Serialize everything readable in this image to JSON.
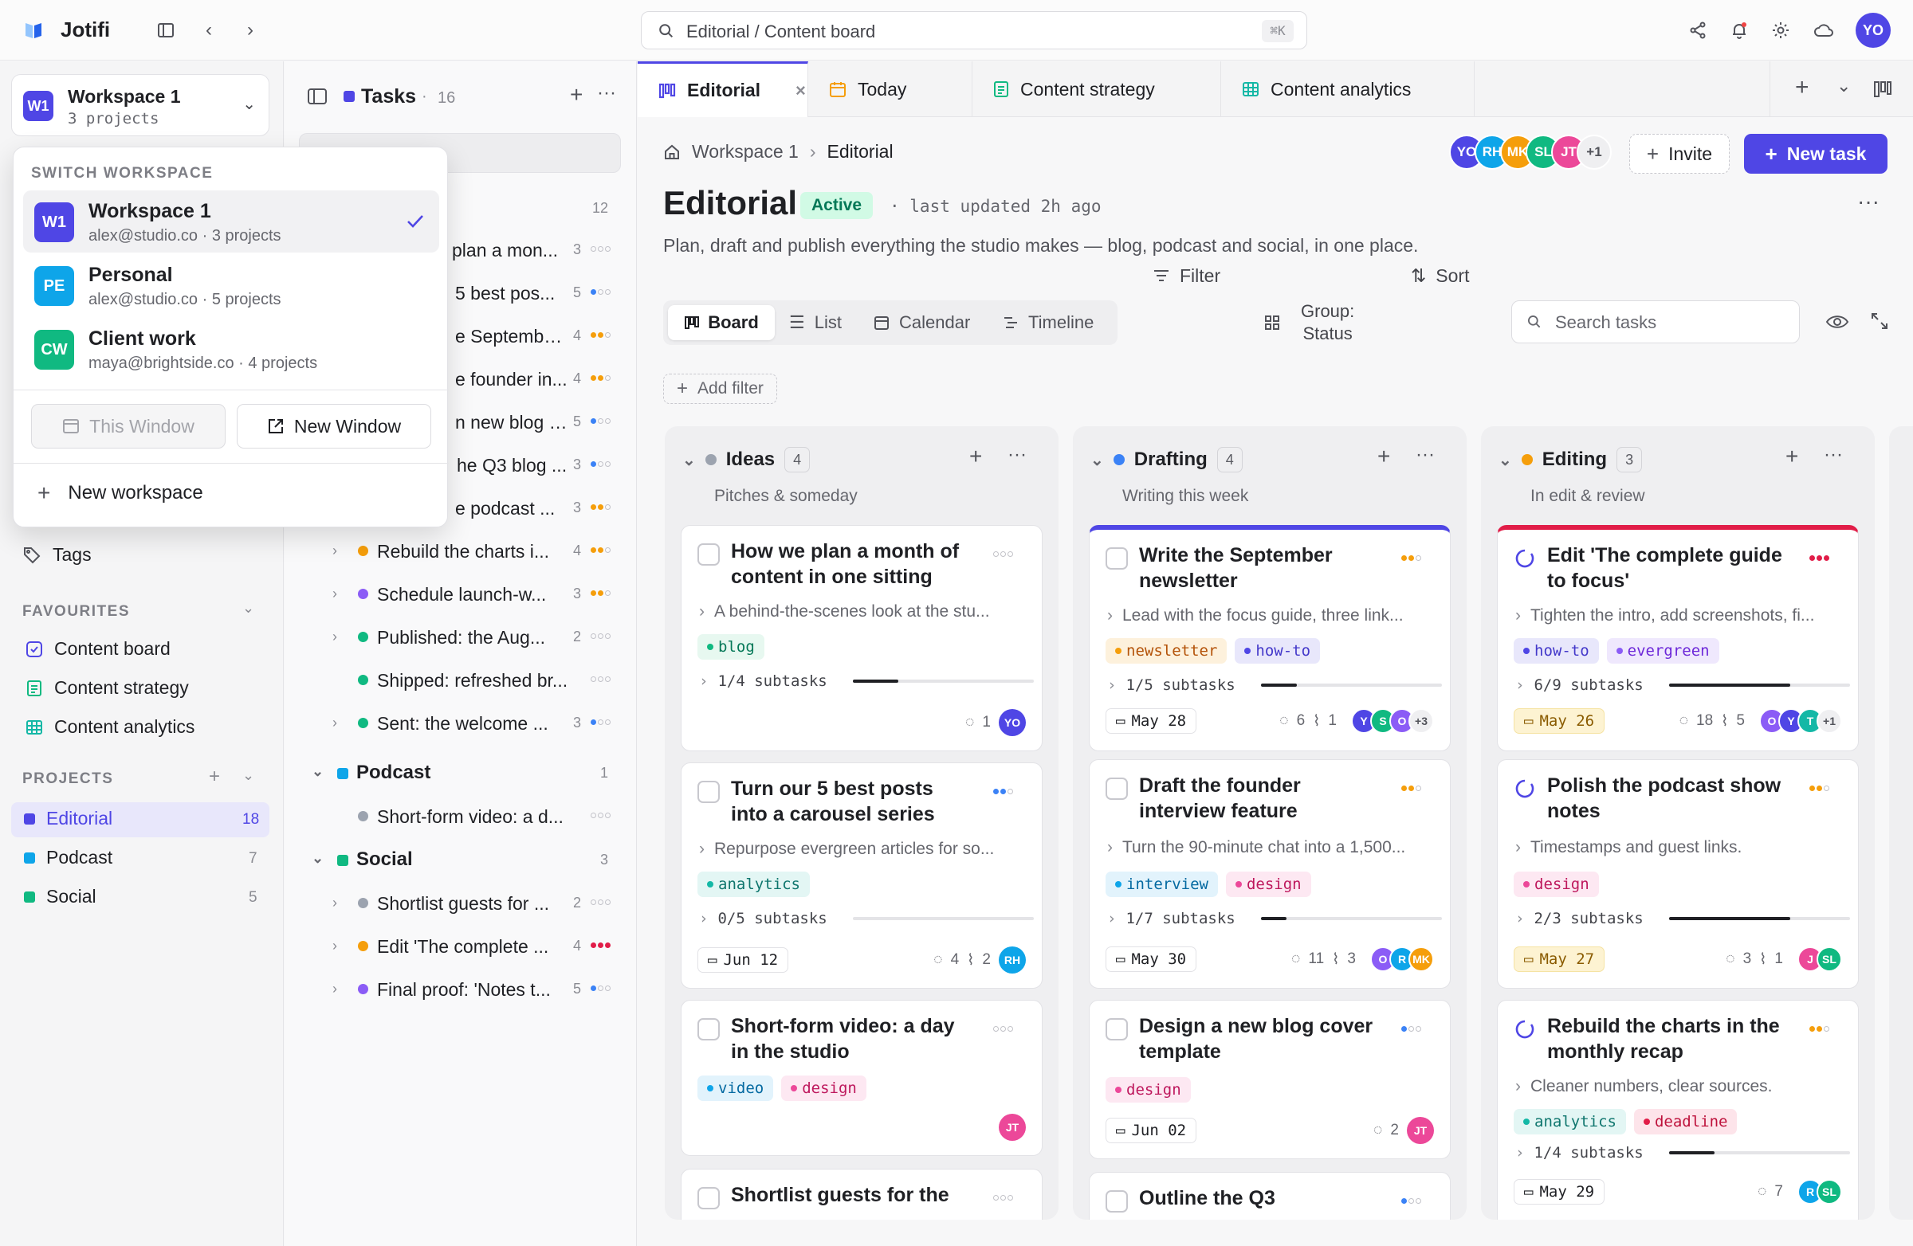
{
  "app": {
    "name": "Jotifi"
  },
  "search": {
    "placeholder": "Editorial / Content board",
    "shortcut": "⌘K"
  },
  "user": {
    "initials": "YO",
    "color": "#4f46e5"
  },
  "workspace": {
    "badge": "W1",
    "name": "Workspace 1",
    "projects": "3 projects"
  },
  "ws_menu": {
    "title": "SWITCH WORKSPACE",
    "options": [
      {
        "badge": "W1",
        "name": "Workspace 1",
        "sub": "alex@studio.co · 3 projects",
        "color": "#4f46e5",
        "selected": true
      },
      {
        "badge": "PE",
        "name": "Personal",
        "sub": "alex@studio.co · 5 projects",
        "color": "#0ea5e9",
        "selected": false
      },
      {
        "badge": "CW",
        "name": "Client work",
        "sub": "maya@brightside.co · 4 projects",
        "color": "#10b981",
        "selected": false
      }
    ],
    "this_window": "This Window",
    "new_window": "New Window",
    "new_workspace": "New workspace"
  },
  "sidebar": {
    "tags": "Tags",
    "favourites_title": "FAVOURITES",
    "favourites": [
      "Content board",
      "Content strategy",
      "Content analytics"
    ],
    "projects_title": "PROJECTS",
    "projects": [
      {
        "name": "Editorial",
        "count": "18",
        "color": "#4f46e5"
      },
      {
        "name": "Podcast",
        "count": "7",
        "color": "#0ea5e9"
      },
      {
        "name": "Social",
        "count": "5",
        "color": "#10b981"
      }
    ]
  },
  "tasks_panel": {
    "title": "Tasks",
    "sep": "·",
    "count": "16",
    "group_count": "12",
    "rows": [
      {
        "text": "How we plan a mon...",
        "visible": "plan a mon...",
        "count": "3"
      },
      {
        "text": "Turn our 5 best pos...",
        "visible": "5 best pos...",
        "count": "5"
      },
      {
        "text": "Write the Septembe...",
        "visible": "e Septembe...",
        "count": "4"
      },
      {
        "text": "Draft the founder in...",
        "visible": "e founder in...",
        "count": "4"
      },
      {
        "text": "Design a new blog co...",
        "visible": "n new blog co...",
        "count": "5"
      },
      {
        "text": "Outline the Q3 blog ...",
        "visible": "he Q3 blog ...",
        "count": "3"
      },
      {
        "text": "Polish the podcast ...",
        "visible": "e podcast ...",
        "count": "3"
      },
      {
        "text": "Rebuild the charts i...",
        "count": "4",
        "color": "#f59e0b"
      },
      {
        "text": "Schedule launch-w...",
        "count": "3",
        "color": "#8b5cf6"
      },
      {
        "text": "Published: the Aug...",
        "count": "2",
        "color": "#10b981"
      },
      {
        "text": "Shipped: refreshed br...",
        "count": "",
        "color": "#10b981"
      },
      {
        "text": "Sent: the welcome ...",
        "count": "3",
        "color": "#10b981"
      }
    ],
    "podcast": {
      "name": "Podcast",
      "count": "1",
      "rows": [
        {
          "text": "Short-form video: a d...",
          "color": "#9ca3af"
        }
      ]
    },
    "social": {
      "name": "Social",
      "count": "3",
      "rows": [
        {
          "text": "Shortlist guests for ...",
          "count": "2",
          "color": "#9ca3af"
        },
        {
          "text": "Edit 'The complete ...",
          "count": "4",
          "color": "#f59e0b"
        },
        {
          "text": "Final proof: 'Notes t...",
          "count": "5",
          "color": "#8b5cf6"
        }
      ]
    }
  },
  "tabs": [
    {
      "label": "Editorial",
      "icon": "board-icon",
      "active": true
    },
    {
      "label": "Today",
      "icon": "calendar-icon"
    },
    {
      "label": "Content strategy",
      "icon": "doc-icon"
    },
    {
      "label": "Content analytics",
      "icon": "table-icon"
    }
  ],
  "breadcrumb": {
    "home": "Workspace 1",
    "current": "Editorial"
  },
  "header": {
    "title": "Editorial",
    "status": "Active",
    "updated": "· last updated 2h ago",
    "description": "Plan, draft and publish everything the studio makes — blog, podcast and social, in one place.",
    "invite": "Invite",
    "new_task": "New task",
    "more_members": "+1"
  },
  "members": [
    {
      "initials": "YO",
      "color": "#4f46e5"
    },
    {
      "initials": "RH",
      "color": "#0ea5e9"
    },
    {
      "initials": "MK",
      "color": "#f59e0b"
    },
    {
      "initials": "SL",
      "color": "#10b981"
    },
    {
      "initials": "JT",
      "color": "#ec4899"
    }
  ],
  "views": [
    {
      "label": "Board",
      "active": true
    },
    {
      "label": "List"
    },
    {
      "label": "Calendar"
    },
    {
      "label": "Timeline"
    }
  ],
  "toolbar": {
    "filter": "Filter",
    "group_line1": "Group:",
    "group_line2": "Status",
    "sort": "Sort",
    "search_placeholder": "Search tasks",
    "add_filter": "Add filter"
  },
  "columns": [
    {
      "name": "Ideas",
      "count": "4",
      "sub": "Pitches & someday",
      "color": "#9ca3af"
    },
    {
      "name": "Drafting",
      "count": "4",
      "sub": "Writing this week",
      "color": "#3b82f6"
    },
    {
      "name": "Editing",
      "count": "3",
      "sub": "In edit & review",
      "color": "#f59e0b"
    }
  ],
  "cards": {
    "c1": {
      "title": "How we plan a month of content in one sitting",
      "desc": "A behind-the-scenes look at the stu...",
      "tags": [
        "blog"
      ],
      "subtasks": "1/4 subtasks",
      "progress": 0.25,
      "comments": "1",
      "avatar": "YO"
    },
    "c2": {
      "title": "Turn our 5 best posts into a carousel series",
      "desc": "Repurpose evergreen articles for so...",
      "tags": [
        "analytics"
      ],
      "subtasks": "0/5 subtasks",
      "progress": 0,
      "due": "Jun 12",
      "comments": "4",
      "attachments": "2",
      "avatar": "RH"
    },
    "c3": {
      "title": "Short-form video: a day in the studio",
      "tags": [
        "video",
        "design"
      ],
      "avatar": "JT"
    },
    "c4": {
      "title": "Shortlist guests for the"
    },
    "d1": {
      "title": "Write the September newsletter",
      "desc": "Lead with the focus guide, three link...",
      "tags": [
        "newsletter",
        "how-to"
      ],
      "subtasks": "1/5 subtasks",
      "progress": 0.2,
      "due": "May 28",
      "comments": "6",
      "attachments": "1",
      "extra": "+3"
    },
    "d2": {
      "title": "Draft the founder interview feature",
      "desc": "Turn the 90-minute chat into a 1,500...",
      "tags": [
        "interview",
        "design"
      ],
      "subtasks": "1/7 subtasks",
      "progress": 0.14,
      "due": "May 30",
      "comments": "11",
      "attachments": "3"
    },
    "d3": {
      "title": "Design a new blog cover template",
      "tags": [
        "design"
      ],
      "due": "Jun 02",
      "comments": "2",
      "avatar": "JT"
    },
    "d4": {
      "title": "Outline the Q3"
    },
    "e1": {
      "title": "Edit 'The complete guide to focus'",
      "desc": "Tighten the intro, add screenshots, fi...",
      "tags": [
        "how-to",
        "evergreen"
      ],
      "subtasks": "6/9 subtasks",
      "progress": 0.67,
      "due": "May 26",
      "comments": "18",
      "attachments": "5",
      "extra": "+1"
    },
    "e2": {
      "title": "Polish the podcast show notes",
      "desc": "Timestamps and guest links.",
      "tags": [
        "design"
      ],
      "subtasks": "2/3 subtasks",
      "progress": 0.67,
      "due": "May 27",
      "comments": "3",
      "attachments": "1"
    },
    "e3": {
      "title": "Rebuild the charts in the monthly recap",
      "desc": "Cleaner numbers, clear sources.",
      "tags": [
        "analytics",
        "deadline"
      ],
      "subtasks": "1/4 subtasks",
      "progress": 0.25,
      "due": "May 29",
      "comments": "7"
    }
  },
  "tag_colors": {
    "blog": "#10b981",
    "analytics": "#14b8a6",
    "video": "#0ea5e9",
    "design": "#ec4899",
    "newsletter": "#f59e0b",
    "how-to": "#4f46e5",
    "interview": "#0ea5e9",
    "evergreen": "#8b5cf6",
    "deadline": "#e11d48"
  }
}
